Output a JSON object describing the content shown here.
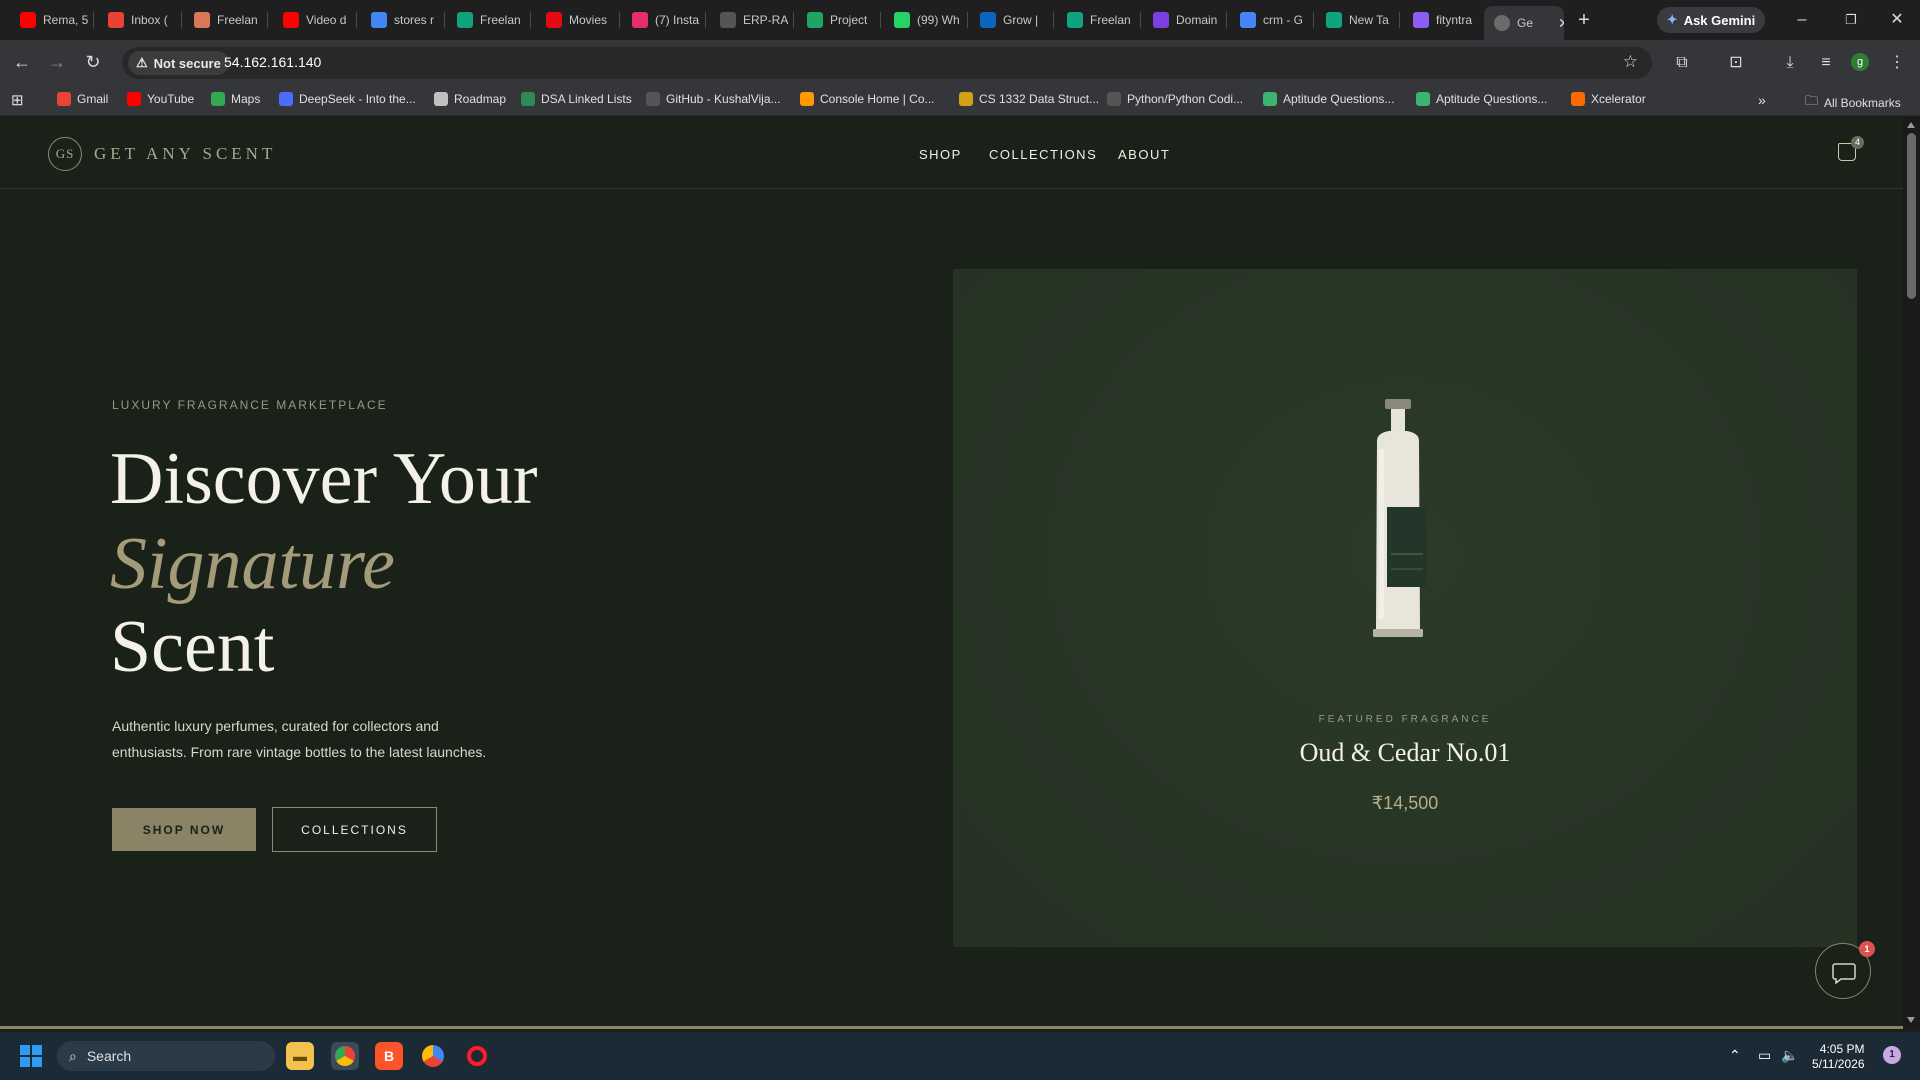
{
  "browser": {
    "tabs": [
      {
        "label": "Rema, 5",
        "icon": "youtube-icon",
        "color": "#ff0000"
      },
      {
        "label": "Inbox (",
        "icon": "gmail-icon",
        "color": "#ea4335"
      },
      {
        "label": "Freelan",
        "icon": "claude-icon",
        "color": "#d97757"
      },
      {
        "label": "Video d",
        "icon": "youtube-icon",
        "color": "#ff0000"
      },
      {
        "label": "stores r",
        "icon": "google-icon",
        "color": "#4285f4"
      },
      {
        "label": "Freelan",
        "icon": "chatgpt-icon",
        "color": "#10a37f"
      },
      {
        "label": "Movies",
        "icon": "netflix-icon",
        "color": "#e50914"
      },
      {
        "label": "(7) Insta",
        "icon": "instagram-icon",
        "color": "#e1306c"
      },
      {
        "label": "ERP-RA",
        "icon": "github-icon",
        "color": "#555555"
      },
      {
        "label": "Project",
        "icon": "drive-icon",
        "color": "#1fa463"
      },
      {
        "label": "(99) Wh",
        "icon": "whatsapp-icon",
        "color": "#25d366"
      },
      {
        "label": "Grow |",
        "icon": "linkedin-icon",
        "color": "#0a66c2"
      },
      {
        "label": "Freelan",
        "icon": "chatgpt-icon",
        "color": "#10a37f"
      },
      {
        "label": "Domain",
        "icon": "domain-icon",
        "color": "#7b3fe4"
      },
      {
        "label": "crm - G",
        "icon": "google-icon",
        "color": "#4285f4"
      },
      {
        "label": "New Ta",
        "icon": "chatgpt-icon",
        "color": "#10a37f"
      },
      {
        "label": "fityntra",
        "icon": "bolt-icon",
        "color": "#8b5cf6"
      }
    ],
    "active_tab": {
      "label": "Ge",
      "icon": "globe-icon"
    },
    "new_tab": "+",
    "ask_gemini": "Ask Gemini",
    "security": "Not secure",
    "url": "54.162.161.140",
    "profile_initial": "g",
    "bookmarks": [
      {
        "label": "Gmail",
        "icon": "gmail-icon",
        "color": "#ea4335"
      },
      {
        "label": "YouTube",
        "icon": "youtube-icon",
        "color": "#ff0000"
      },
      {
        "label": "Maps",
        "icon": "maps-icon",
        "color": "#34a853"
      },
      {
        "label": "DeepSeek - Into the...",
        "icon": "deepseek-icon",
        "color": "#4d6bfe"
      },
      {
        "label": "Roadmap",
        "icon": "roadmap-icon",
        "color": "#c0c0c0"
      },
      {
        "label": "DSA Linked Lists",
        "icon": "dsa-icon",
        "color": "#2e8b57"
      },
      {
        "label": "GitHub - KushalVija...",
        "icon": "github-icon",
        "color": "#555555"
      },
      {
        "label": "Console Home | Co...",
        "icon": "aws-icon",
        "color": "#ff9900"
      },
      {
        "label": "CS 1332 Data Struct...",
        "icon": "course-icon",
        "color": "#d4a017"
      },
      {
        "label": "Python/Python Codi...",
        "icon": "github-icon",
        "color": "#555555"
      },
      {
        "label": "Aptitude Questions...",
        "icon": "aptitude-icon",
        "color": "#3cb371"
      },
      {
        "label": "Aptitude Questions...",
        "icon": "aptitude-icon",
        "color": "#3cb371"
      },
      {
        "label": "Xcelerator",
        "icon": "xcelerator-icon",
        "color": "#ff6a00"
      }
    ],
    "all_bookmarks": "All Bookmarks"
  },
  "site": {
    "logo_mark": "GS",
    "logo_text": "GET ANY SCENT",
    "nav": [
      "SHOP",
      "COLLECTIONS",
      "ABOUT"
    ],
    "cart_count": "4",
    "hero": {
      "eyebrow": "LUXURY FRAGRANCE MARKETPLACE",
      "line1": "Discover Your",
      "line2": "Signature",
      "line3": "Scent",
      "desc_line1": "Authentic luxury perfumes, curated for collectors and",
      "desc_line2": "enthusiasts. From rare vintage bottles to the latest launches.",
      "cta_primary": "SHOP NOW",
      "cta_secondary": "COLLECTIONS"
    },
    "featured": {
      "label": "FEATURED FRAGRANCE",
      "name": "Oud & Cedar No.01",
      "price": "₹14,500"
    },
    "chat_badge": "1"
  },
  "taskbar": {
    "search_placeholder": "Search",
    "time": "4:05 PM",
    "date": "5/11/2026",
    "notification_count": "1"
  },
  "colors": {
    "site_bg": "#1a2119",
    "accent_gold": "#8a8366",
    "card_bg": "#283626"
  }
}
